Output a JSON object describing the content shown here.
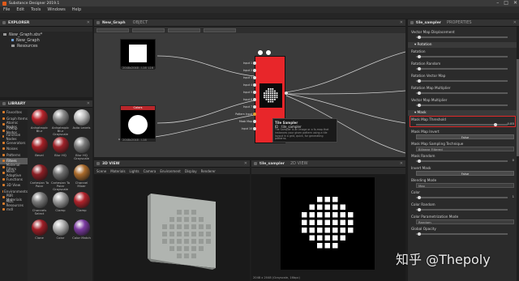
{
  "app": {
    "title": "Substance Designer 2019.1"
  },
  "menu": [
    "File",
    "Edit",
    "Tools",
    "Windows",
    "Help"
  ],
  "explorer": {
    "title": "EXPLORER",
    "items": [
      {
        "label": "New_Graph.sbs*"
      },
      {
        "label": "New_Graph"
      },
      {
        "label": "Resources"
      }
    ]
  },
  "library": {
    "title": "LIBRARY",
    "search_placeholder": "Search",
    "categories": [
      "Favorites",
      "Graph Items",
      "Atomic Nodes",
      "FxMap Nodes",
      "Function Nodes",
      "Generators",
      "Noises",
      "Patterns",
      "Filters",
      "Material Filters",
      "Mesh Adaptive",
      "Functions",
      "3D View",
      "Environments",
      "PBR Materials",
      "MDL Resources",
      "mdl"
    ],
    "selected_category": "Filters",
    "thumbnails": [
      {
        "label": "Anisotropic Blur",
        "color": "#b8232a"
      },
      {
        "label": "Anisotropic Blur Grayscale",
        "color": "#8a8a8a"
      },
      {
        "label": "Auto Levels",
        "color": "#bdbdbd"
      },
      {
        "label": "Bevel",
        "color": "#a51f25"
      },
      {
        "label": "Blur HQ",
        "color": "#9e2229"
      },
      {
        "label": "Blur HQ Grayscale",
        "color": "#7a7a7a"
      },
      {
        "label": "Cartesian To Polar",
        "color": "#8c1e24"
      },
      {
        "label": "Cartesian To Polar Grayscale",
        "color": "#6e6e6e"
      },
      {
        "label": "Channel Mixer",
        "color": "#aa6a2a"
      },
      {
        "label": "Channels Select",
        "color": "#7a7a7a"
      },
      {
        "label": "Clamp",
        "color": "#9a9a9a"
      },
      {
        "label": "Clamp",
        "color": "#b0222a"
      },
      {
        "label": "Clone",
        "color": "#a01e26"
      },
      {
        "label": "Color",
        "color": "#b0b0b0"
      },
      {
        "label": "Color Match",
        "color": "#7a3aa0"
      }
    ]
  },
  "graph": {
    "title": "New_Graph",
    "tab2": "OBJECT",
    "node1_footer": "2048x2048 - L16",
    "node2_title": "Colors",
    "node2_footer": "2048x2048 - L16",
    "tile_node_inputs": [
      "Input 1",
      "Input 2",
      "Input 3",
      "Input 4",
      "Input 5",
      "Input 6",
      "Input 7",
      "Pattern Input",
      "Mask Map",
      "Input 10"
    ],
    "tooltip": {
      "title": "Tile Sampler",
      "id": "ID : tile_sampler",
      "desc": "Tile Sampler is an image or a fx-map that instances your given pattern using a tile layout in a grid, quick, for generating patterns."
    }
  },
  "viewport3d": {
    "title": "3D VIEW",
    "toolbar": [
      "Scene",
      "Materials",
      "Lights",
      "Camera",
      "Environment",
      "Display",
      "Renderer"
    ]
  },
  "viewport2d": {
    "title": "2D VIEW",
    "tab": "tile_sampler",
    "footer": "2048 x 2048 (Grayscale, 16bpc)"
  },
  "properties": {
    "title": "PROPERTIES",
    "tab": "tile_sampler",
    "rows": [
      {
        "label": "Vector Map Displacement"
      },
      {
        "section": "Rotation"
      },
      {
        "label": "Rotation"
      },
      {
        "label": "Rotation Random"
      },
      {
        "label": "Rotation Vector Map"
      },
      {
        "label": "Rotation Map Multiplier"
      },
      {
        "label": "Vector Map Multiplier"
      },
      {
        "section": "Mask"
      },
      {
        "label": "Mask Map Threshold",
        "value": "0.85"
      },
      {
        "label": "Mask Map Invert",
        "button": "False"
      },
      {
        "label": "Mask Map Sampling Technique",
        "dropdown": "Bilinear Filtered"
      },
      {
        "label": "Mask Random",
        "value": "0"
      },
      {
        "label": "Invert Mask",
        "button": "False"
      },
      {
        "label": "Blending Mode",
        "dropdown": "Max"
      },
      {
        "label": "Color",
        "value": "1"
      },
      {
        "label": "Color Random"
      },
      {
        "label": "Color Parametrization Mode",
        "dropdown": "Random"
      },
      {
        "label": "Global Opacity"
      }
    ]
  },
  "watermark": "知乎 @Thepoly"
}
